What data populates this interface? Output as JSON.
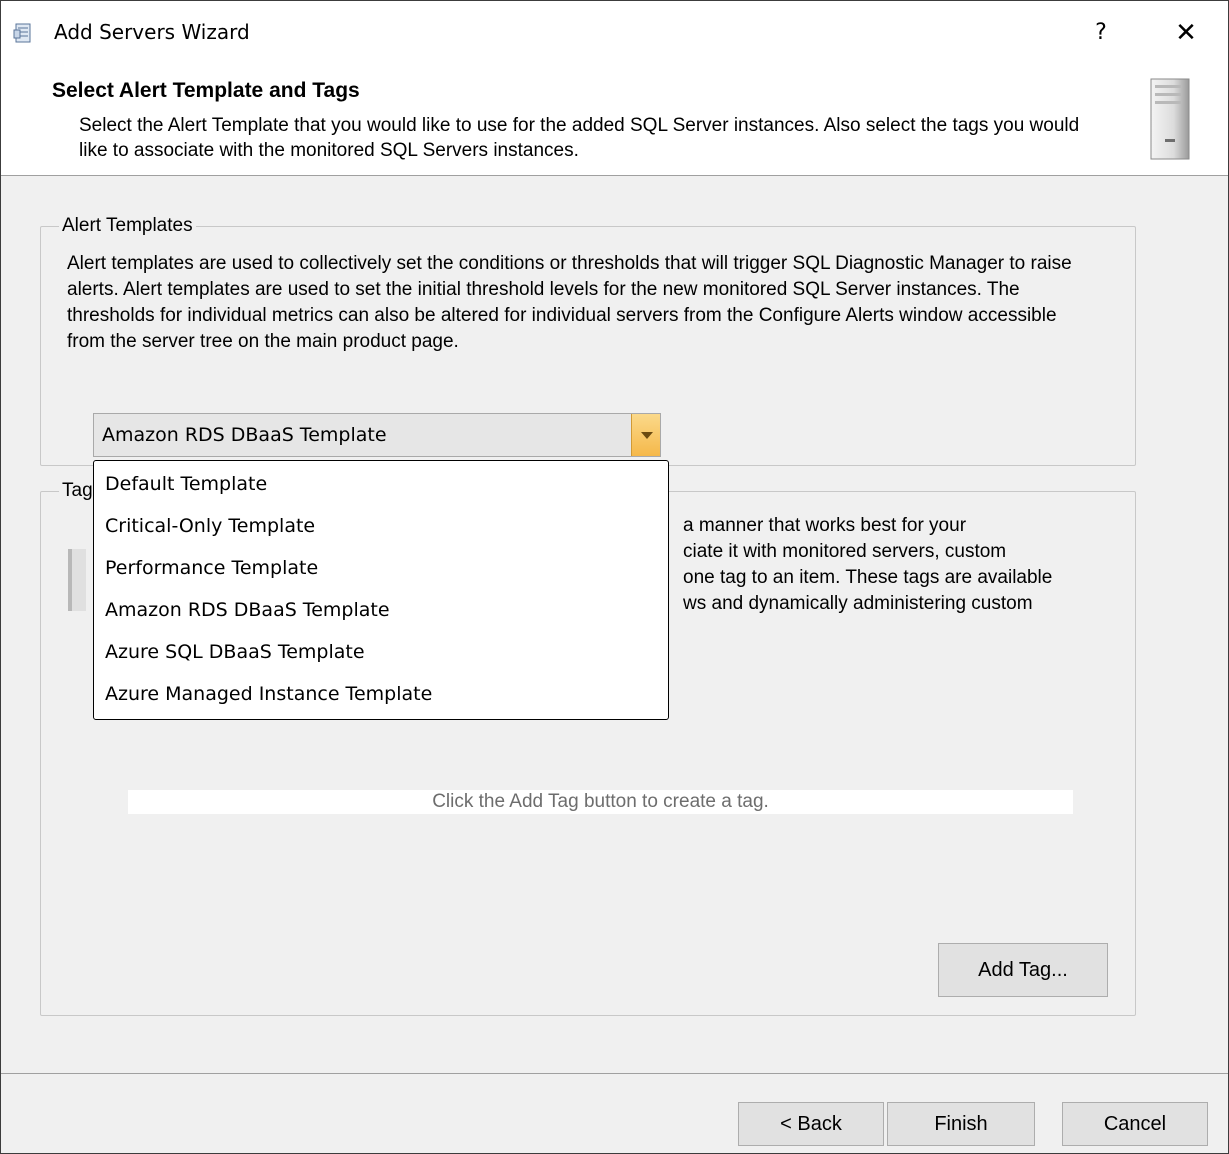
{
  "window": {
    "title": "Add Servers Wizard",
    "help_label": "?",
    "close_label": "✕"
  },
  "header": {
    "title": "Select Alert Template and Tags",
    "description": "Select the Alert Template that you would like to use for the added SQL Server instances. Also select the tags you would like to associate with the monitored SQL Servers instances."
  },
  "alert_templates": {
    "legend": "Alert Templates",
    "description": "Alert templates are used to collectively set the conditions or thresholds that will trigger SQL Diagnostic Manager to raise alerts.  Alert templates are used to set the initial threshold levels for the new monitored SQL Server instances.  The thresholds for individual metrics can also be altered for individual servers from the Configure Alerts window accessible from the server tree on the main product page.",
    "selected": "Amazon RDS DBaaS Template",
    "options": [
      "Default Template",
      "Critical-Only Template",
      "Performance Template",
      "Amazon RDS DBaaS Template",
      "Azure SQL DBaaS Template",
      "Azure Managed Instance Template"
    ]
  },
  "tags": {
    "legend_visible": "Tag",
    "description_lines": [
      "a manner that works best for your",
      "ciate it with monitored servers, custom",
      "one tag to an item. These tags are available",
      "ws and dynamically administering custom"
    ],
    "empty_message": "Click the Add Tag button to create a tag.",
    "add_tag_label": "Add Tag..."
  },
  "footer": {
    "back_label": "< Back",
    "finish_label": "Finish",
    "cancel_label": "Cancel"
  }
}
